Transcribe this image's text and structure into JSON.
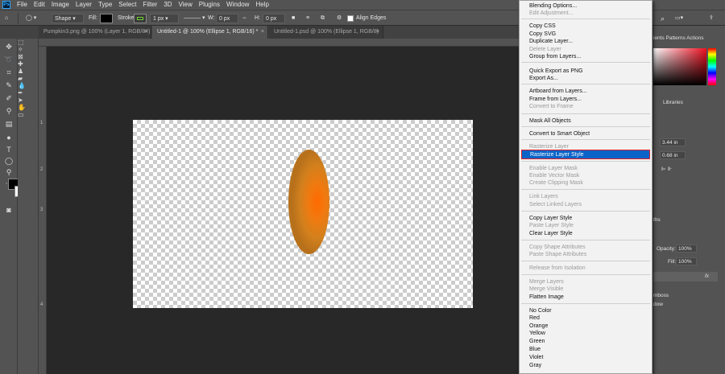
{
  "menubar": {
    "items": [
      "File",
      "Edit",
      "Image",
      "Layer",
      "Type",
      "Select",
      "Filter",
      "3D",
      "View",
      "Plugins",
      "Window",
      "Help"
    ]
  },
  "options": {
    "shape_mode": "Shape",
    "fill_label": "Fill:",
    "stroke_label": "Stroke:",
    "stroke_width": "1 px",
    "w_label": "W:",
    "w_value": "0 px",
    "h_label": "H:",
    "h_value": "0 px",
    "align_edges": "Align Edges"
  },
  "tabs": [
    {
      "label": "Pumpkin3.png @ 100% (Layer 1, RGB/8#)"
    },
    {
      "label": "Untitled-1 @ 100% (Ellipse 1, RGB/16) *"
    },
    {
      "label": "Untitled-1.psd @ 100% (Ellipse 1, RGB/8)"
    }
  ],
  "ruler_left": [
    "1",
    "2",
    "3",
    "4"
  ],
  "right_panel": {
    "top_tabs": "ients  Patterns  Actions",
    "mid_tabs": "Libraries",
    "w_value": "3.44 in",
    "h_value": "0.68 in",
    "layers_tab": "ths",
    "opacity_label": "Opacity:",
    "opacity_value": "100%",
    "fill_label": "Fill:",
    "fill_value": "100%",
    "fx_label": "fx",
    "effect1": "mboss",
    "effect2": "dow"
  },
  "context_menu": {
    "items": [
      {
        "label": "Blending Options...",
        "enabled": true
      },
      {
        "label": "Edit Adjustment...",
        "enabled": false
      },
      {
        "label": "Copy CSS",
        "enabled": true
      },
      {
        "label": "Copy SVG",
        "enabled": true
      },
      {
        "label": "Duplicate Layer...",
        "enabled": true
      },
      {
        "label": "Delete Layer",
        "enabled": false
      },
      {
        "label": "Group from Layers...",
        "enabled": true
      },
      {
        "label": "Quick Export as PNG",
        "enabled": true
      },
      {
        "label": "Export As...",
        "enabled": true
      },
      {
        "label": "Artboard from Layers...",
        "enabled": true
      },
      {
        "label": "Frame from Layers...",
        "enabled": true
      },
      {
        "label": "Convert to Frame",
        "enabled": false
      },
      {
        "label": "Mask All Objects",
        "enabled": true
      },
      {
        "label": "Convert to Smart Object",
        "enabled": true
      },
      {
        "label": "Rasterize Layer",
        "enabled": false
      },
      {
        "label": "Rasterize Layer Style",
        "enabled": true,
        "highlighted": true
      },
      {
        "label": "Enable Layer Mask",
        "enabled": false
      },
      {
        "label": "Enable Vector Mask",
        "enabled": false
      },
      {
        "label": "Create Clipping Mask",
        "enabled": false
      },
      {
        "label": "Link Layers",
        "enabled": false
      },
      {
        "label": "Select Linked Layers",
        "enabled": false
      },
      {
        "label": "Copy Layer Style",
        "enabled": true
      },
      {
        "label": "Paste Layer Style",
        "enabled": false
      },
      {
        "label": "Clear Layer Style",
        "enabled": true
      },
      {
        "label": "Copy Shape Attributes",
        "enabled": false
      },
      {
        "label": "Paste Shape Attributes",
        "enabled": false
      },
      {
        "label": "Release from Isolation",
        "enabled": false
      },
      {
        "label": "Merge Layers",
        "enabled": false
      },
      {
        "label": "Merge Visible",
        "enabled": false
      },
      {
        "label": "Flatten Image",
        "enabled": true
      },
      {
        "label": "No Color",
        "enabled": true
      },
      {
        "label": "Red",
        "enabled": true
      },
      {
        "label": "Orange",
        "enabled": true
      },
      {
        "label": "Yellow",
        "enabled": true
      },
      {
        "label": "Green",
        "enabled": true
      },
      {
        "label": "Blue",
        "enabled": true
      },
      {
        "label": "Violet",
        "enabled": true
      },
      {
        "label": "Gray",
        "enabled": true
      }
    ]
  },
  "colors": {
    "highlight": "#0a64c8",
    "highlight_border": "#e0202a",
    "fill_swatch": "#000000",
    "stroke_swatch": "#6fd12f"
  }
}
